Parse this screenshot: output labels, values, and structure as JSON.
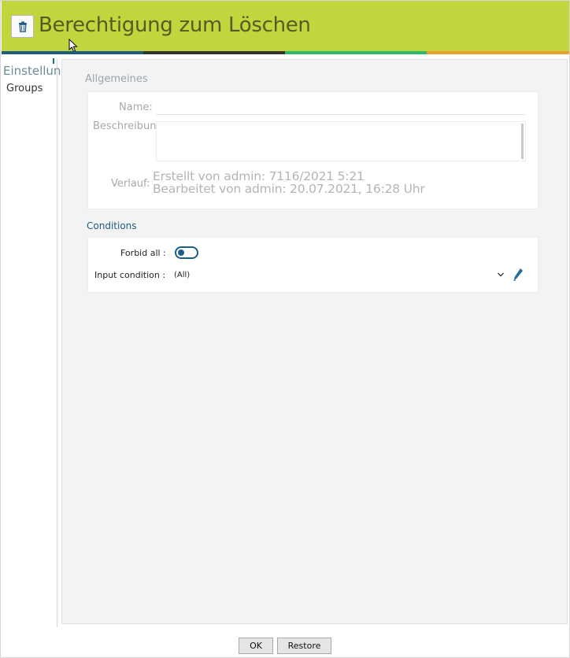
{
  "header": {
    "title": "Berechtigung zum Löschen",
    "icon": "trash-icon",
    "color": "#c3d53c"
  },
  "stripe_colors": [
    "#1d5c80",
    "#333333",
    "#2dbb6b",
    "#f0a030"
  ],
  "sidebar": {
    "tab_label": "Einstellungen",
    "items": [
      {
        "label": "Groups"
      }
    ]
  },
  "general": {
    "section_label": "Allgemeines",
    "name_label": "Name:",
    "name_value": "",
    "description_label": "Beschreibung:",
    "description_value": "",
    "history_label": "Verlauf:",
    "created": "Erstellt von admin: 7116/2021 5:21",
    "edited": "Bearbeitet von admin: 20.07.2021, 16:28 Uhr"
  },
  "conditions": {
    "section_label": "Conditions",
    "forbid_all_label": "Forbid all :",
    "forbid_all_on": false,
    "input_condition_label": "Input condition :",
    "input_condition_value": "(All)"
  },
  "footer": {
    "ok_label": "OK",
    "restore_label": "Restore"
  }
}
